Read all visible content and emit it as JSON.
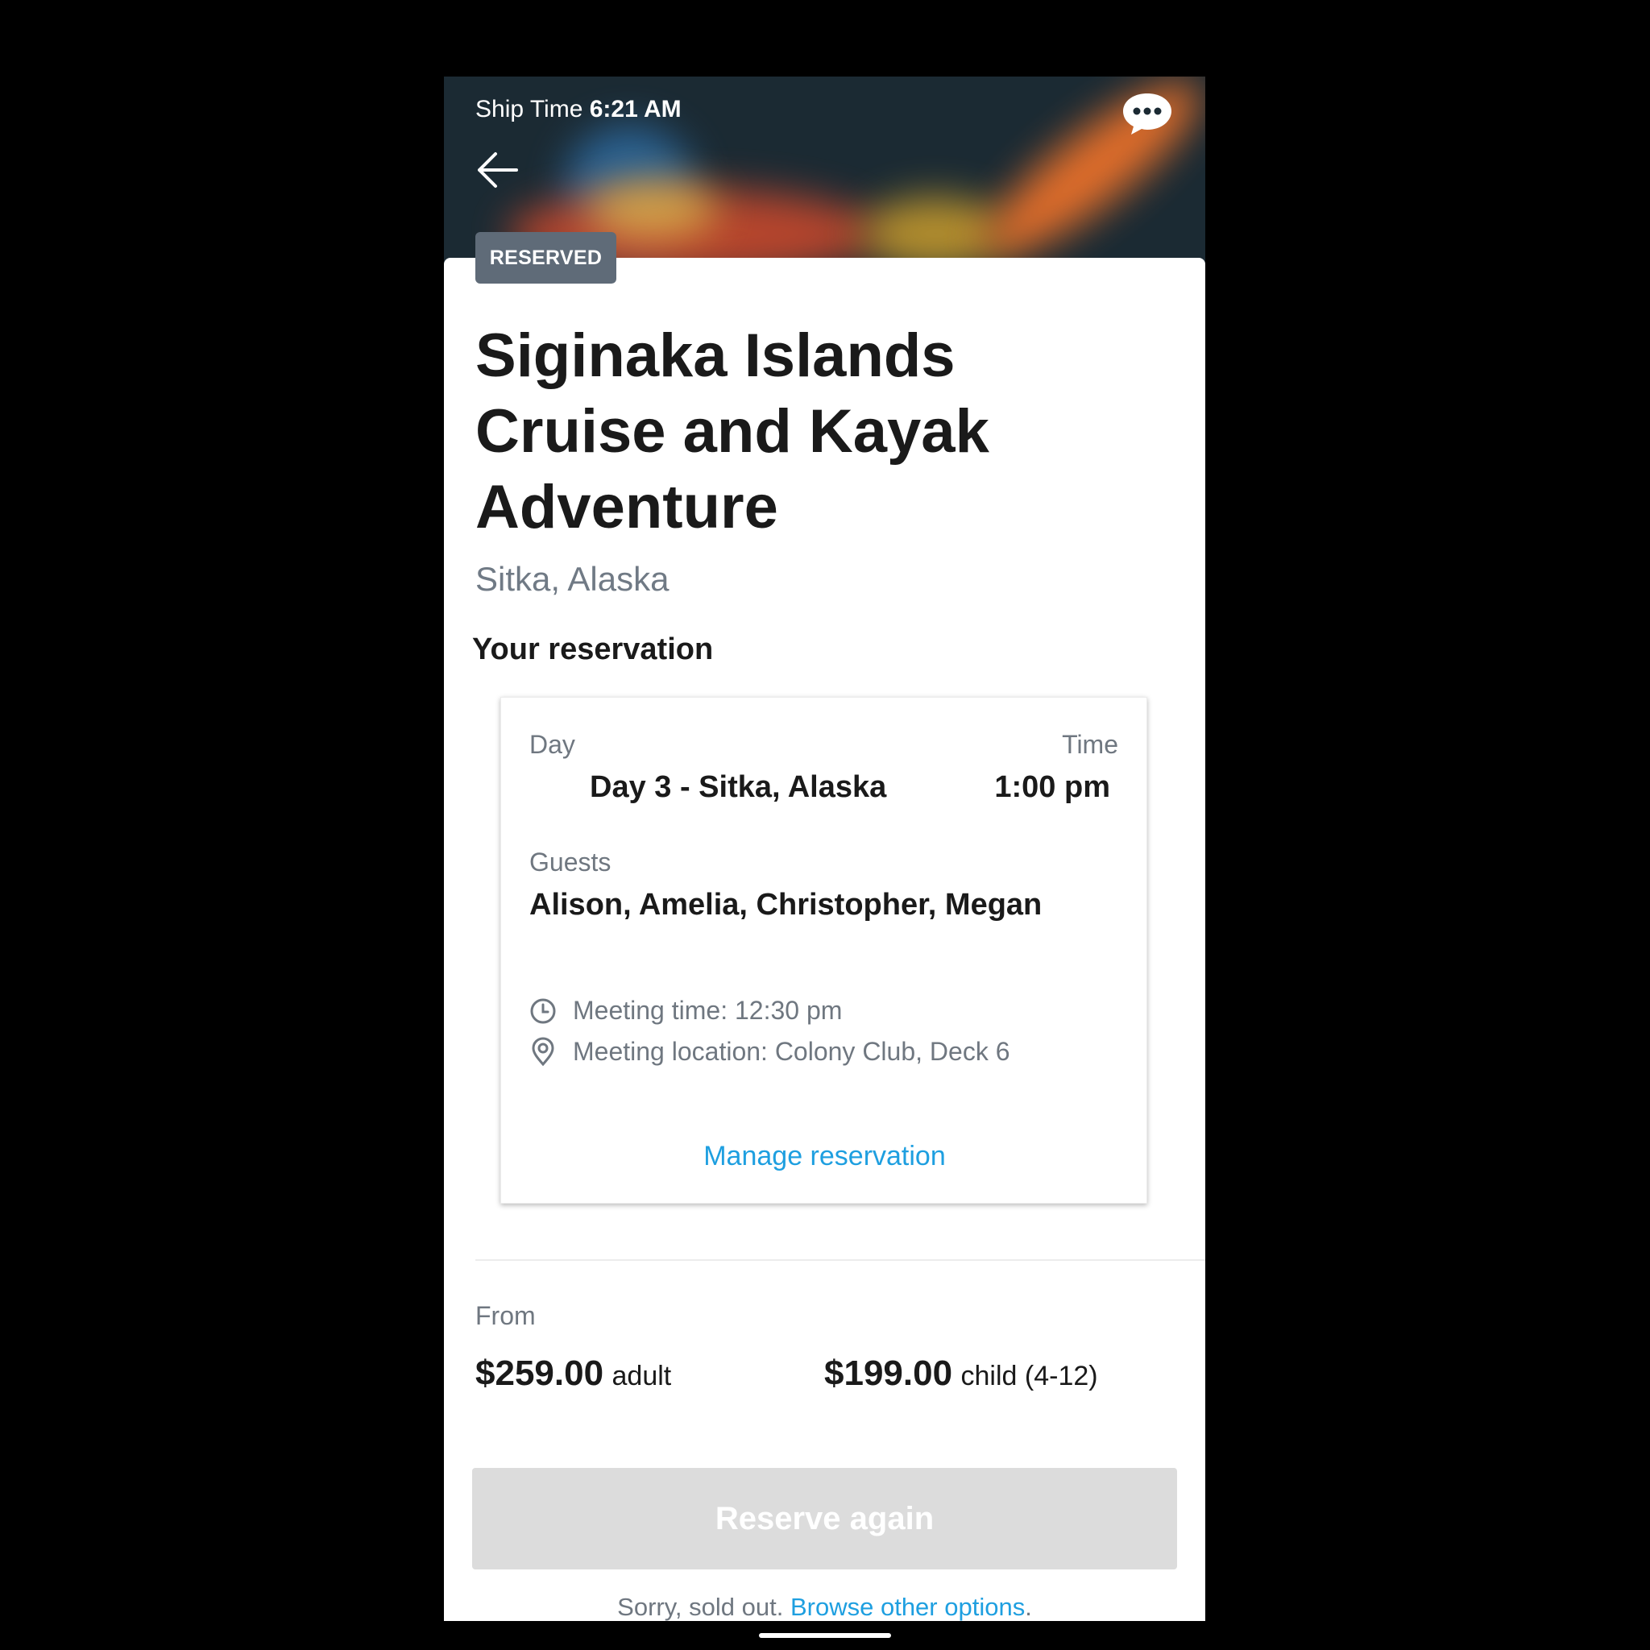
{
  "status_bar": {
    "prefix": "Ship Time",
    "time": "6:21 AM"
  },
  "icons": {
    "back": "back-arrow-icon",
    "chat": "chat-bubble-icon",
    "clock": "clock-icon",
    "pin": "location-pin-icon"
  },
  "badge": "RESERVED",
  "title": "Siginaka Islands Cruise and Kayak Adventure",
  "location": "Sitka, Alaska",
  "reservation": {
    "heading": "Your reservation",
    "day_label": "Day",
    "day_value": "Day 3 - Sitka, Alaska",
    "time_label": "Time",
    "time_value": "1:00 pm",
    "guests_label": "Guests",
    "guests_value": "Alison, Amelia, Christopher, Megan",
    "meeting_time": "Meeting time: 12:30 pm",
    "meeting_location": "Meeting location: Colony Club, Deck 6",
    "manage_label": "Manage reservation"
  },
  "pricing": {
    "from_label": "From",
    "adult_price": "$259.00",
    "adult_unit": "adult",
    "child_price": "$199.00",
    "child_unit": "child (4-12)"
  },
  "reserve_button": "Reserve again",
  "soldout": {
    "text": "Sorry, sold out.",
    "link": "Browse other options",
    "end": "."
  },
  "colors": {
    "accent": "#1e9fe0",
    "badge_bg": "#5f6b78",
    "disabled_button": "#dcdcdc"
  }
}
